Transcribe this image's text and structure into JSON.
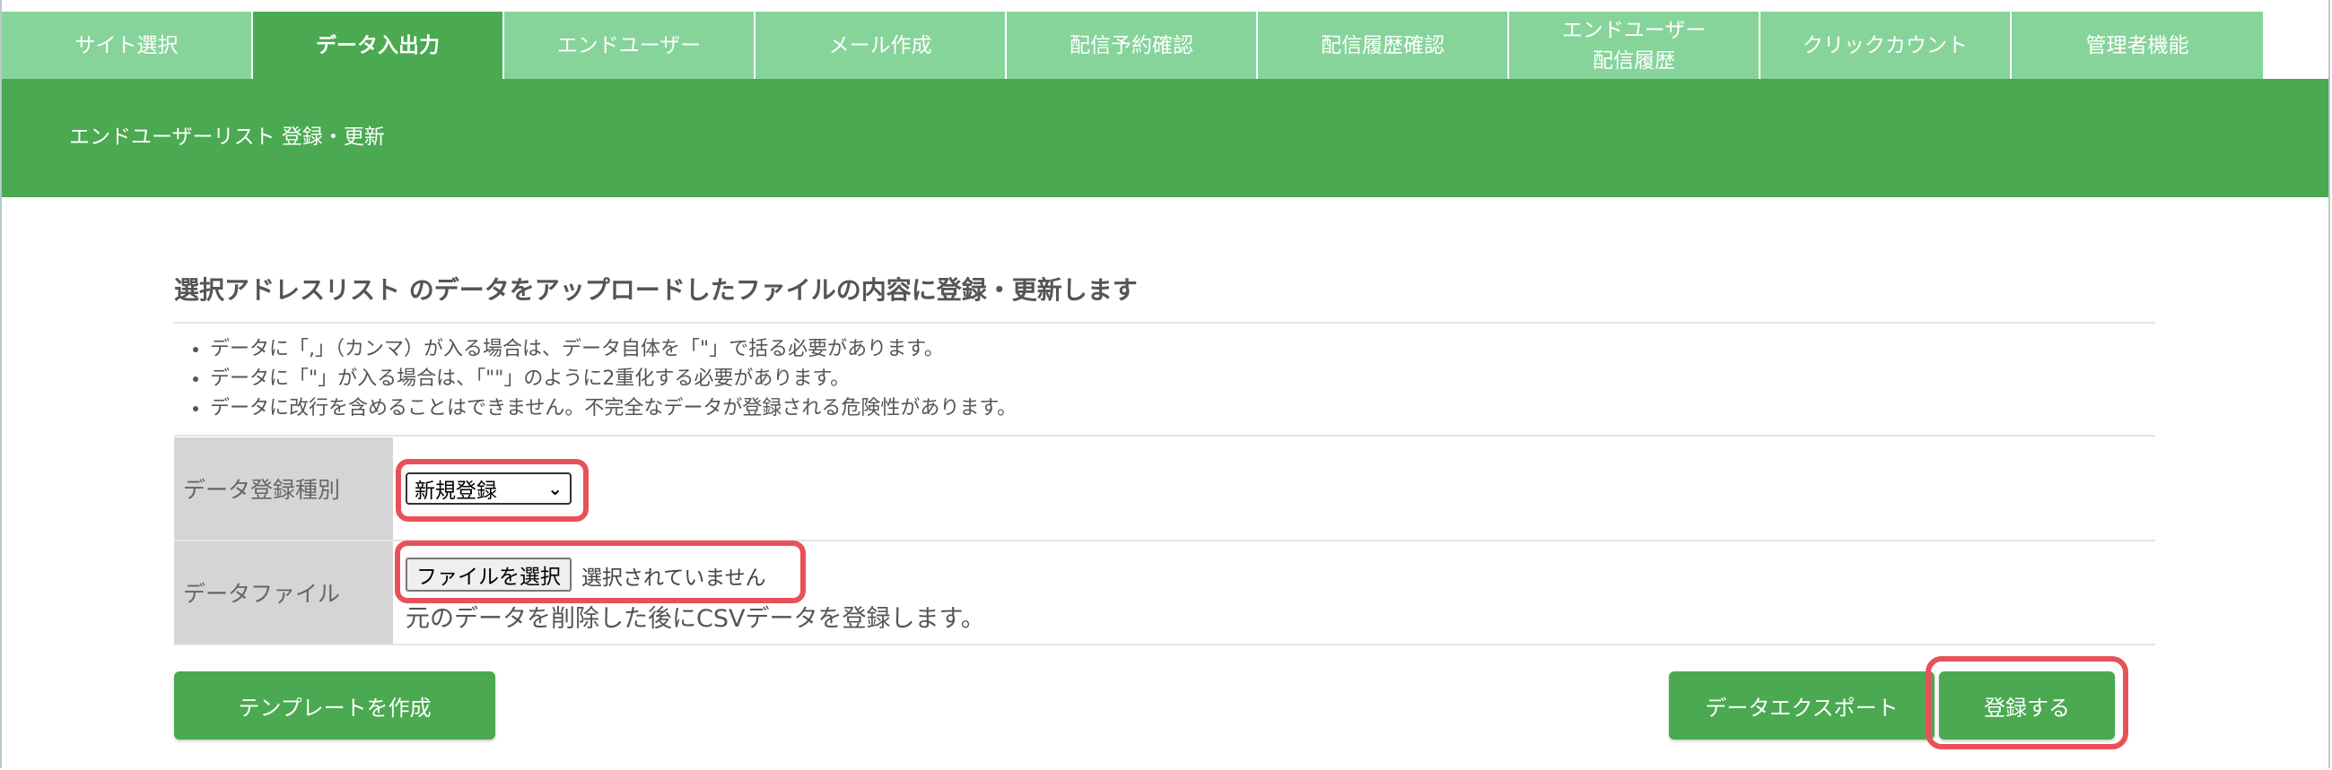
{
  "tabs": [
    {
      "label": "サイト選択",
      "active": false
    },
    {
      "label": "データ入出力",
      "active": true
    },
    {
      "label": "エンドユーザー",
      "active": false
    },
    {
      "label": "メール作成",
      "active": false
    },
    {
      "label": "配信予約確認",
      "active": false
    },
    {
      "label": "配信履歴確認",
      "active": false
    },
    {
      "label": "エンドユーザー\n配信履歴",
      "active": false
    },
    {
      "label": "クリックカウント",
      "active": false
    },
    {
      "label": "管理者機能",
      "active": false
    }
  ],
  "header": {
    "title": "エンドユーザーリスト 登録・更新"
  },
  "main": {
    "section_title": "選択アドレスリスト のデータをアップロードしたファイルの内容に登録・更新します",
    "notes": [
      "データに「,」（カンマ）が入る場合は、データ自体を「\"」で括る必要があります。",
      "データに「\"」が入る場合は、「\"\"」のように2重化する必要があります。",
      "データに改行を含めることはできません。不完全なデータが登録される危険性があります。"
    ],
    "form": {
      "type_label": "データ登録種別",
      "type_selected": "新規登録",
      "file_label": "データファイル",
      "file_button": "ファイルを選択",
      "file_status": "選択されていません",
      "file_hint": "元のデータを削除した後にCSVデータを登録します。"
    },
    "buttons": {
      "template": "テンプレートを作成",
      "export": "データエクスポート",
      "register": "登録する"
    }
  },
  "colors": {
    "tab_inactive": "#86d49a",
    "tab_active": "#4aa951",
    "header_band": "#4aa951",
    "highlight": "#e95159"
  }
}
